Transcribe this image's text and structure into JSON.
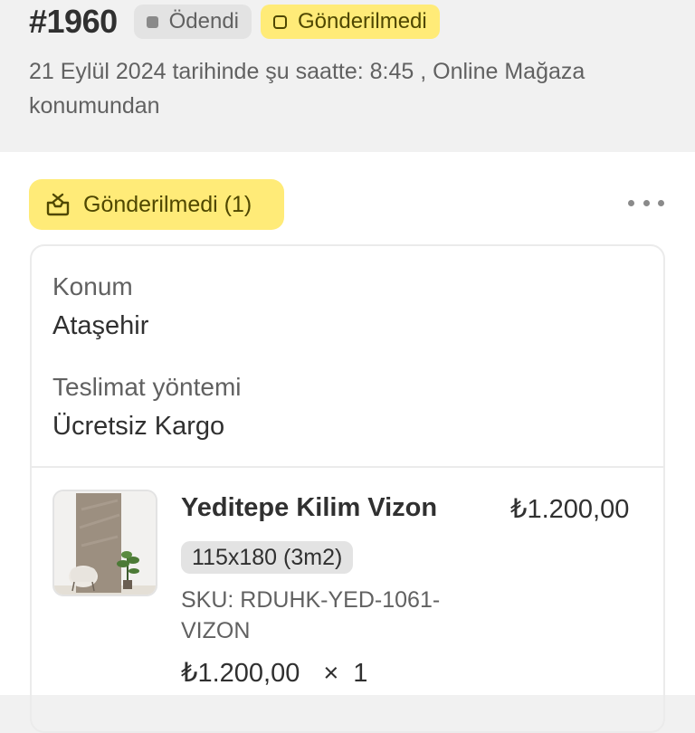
{
  "order": {
    "number": "#1960",
    "payment_status": "Ödendi",
    "fulfillment_status": "Gönderilmedi",
    "meta": "21 Eylül 2024 tarihinde şu saatte: 8:45 , Online Mağaza konumundan"
  },
  "fulfillment": {
    "badge_label": "Gönderilmedi (1)",
    "badge_icon": "unfulfilled-box-icon",
    "more_icon": "more-horizontal-icon",
    "location_label": "Konum",
    "location_value": "Ataşehir",
    "delivery_label": "Teslimat yöntemi",
    "delivery_value": "Ücretsiz Kargo"
  },
  "line_item": {
    "name": "Yeditepe Kilim Vizon",
    "total": "₺1.200,00",
    "variant": "115x180 (3m2)",
    "sku": "SKU: RDUHK-YED-1061-VIZON",
    "unit_price": "₺1.200,00",
    "times": "×",
    "quantity": "1"
  },
  "colors": {
    "attention_yellow": "#ffeb78",
    "paid_gray": "#e3e3e3",
    "page_bg": "#f1f1f1"
  }
}
